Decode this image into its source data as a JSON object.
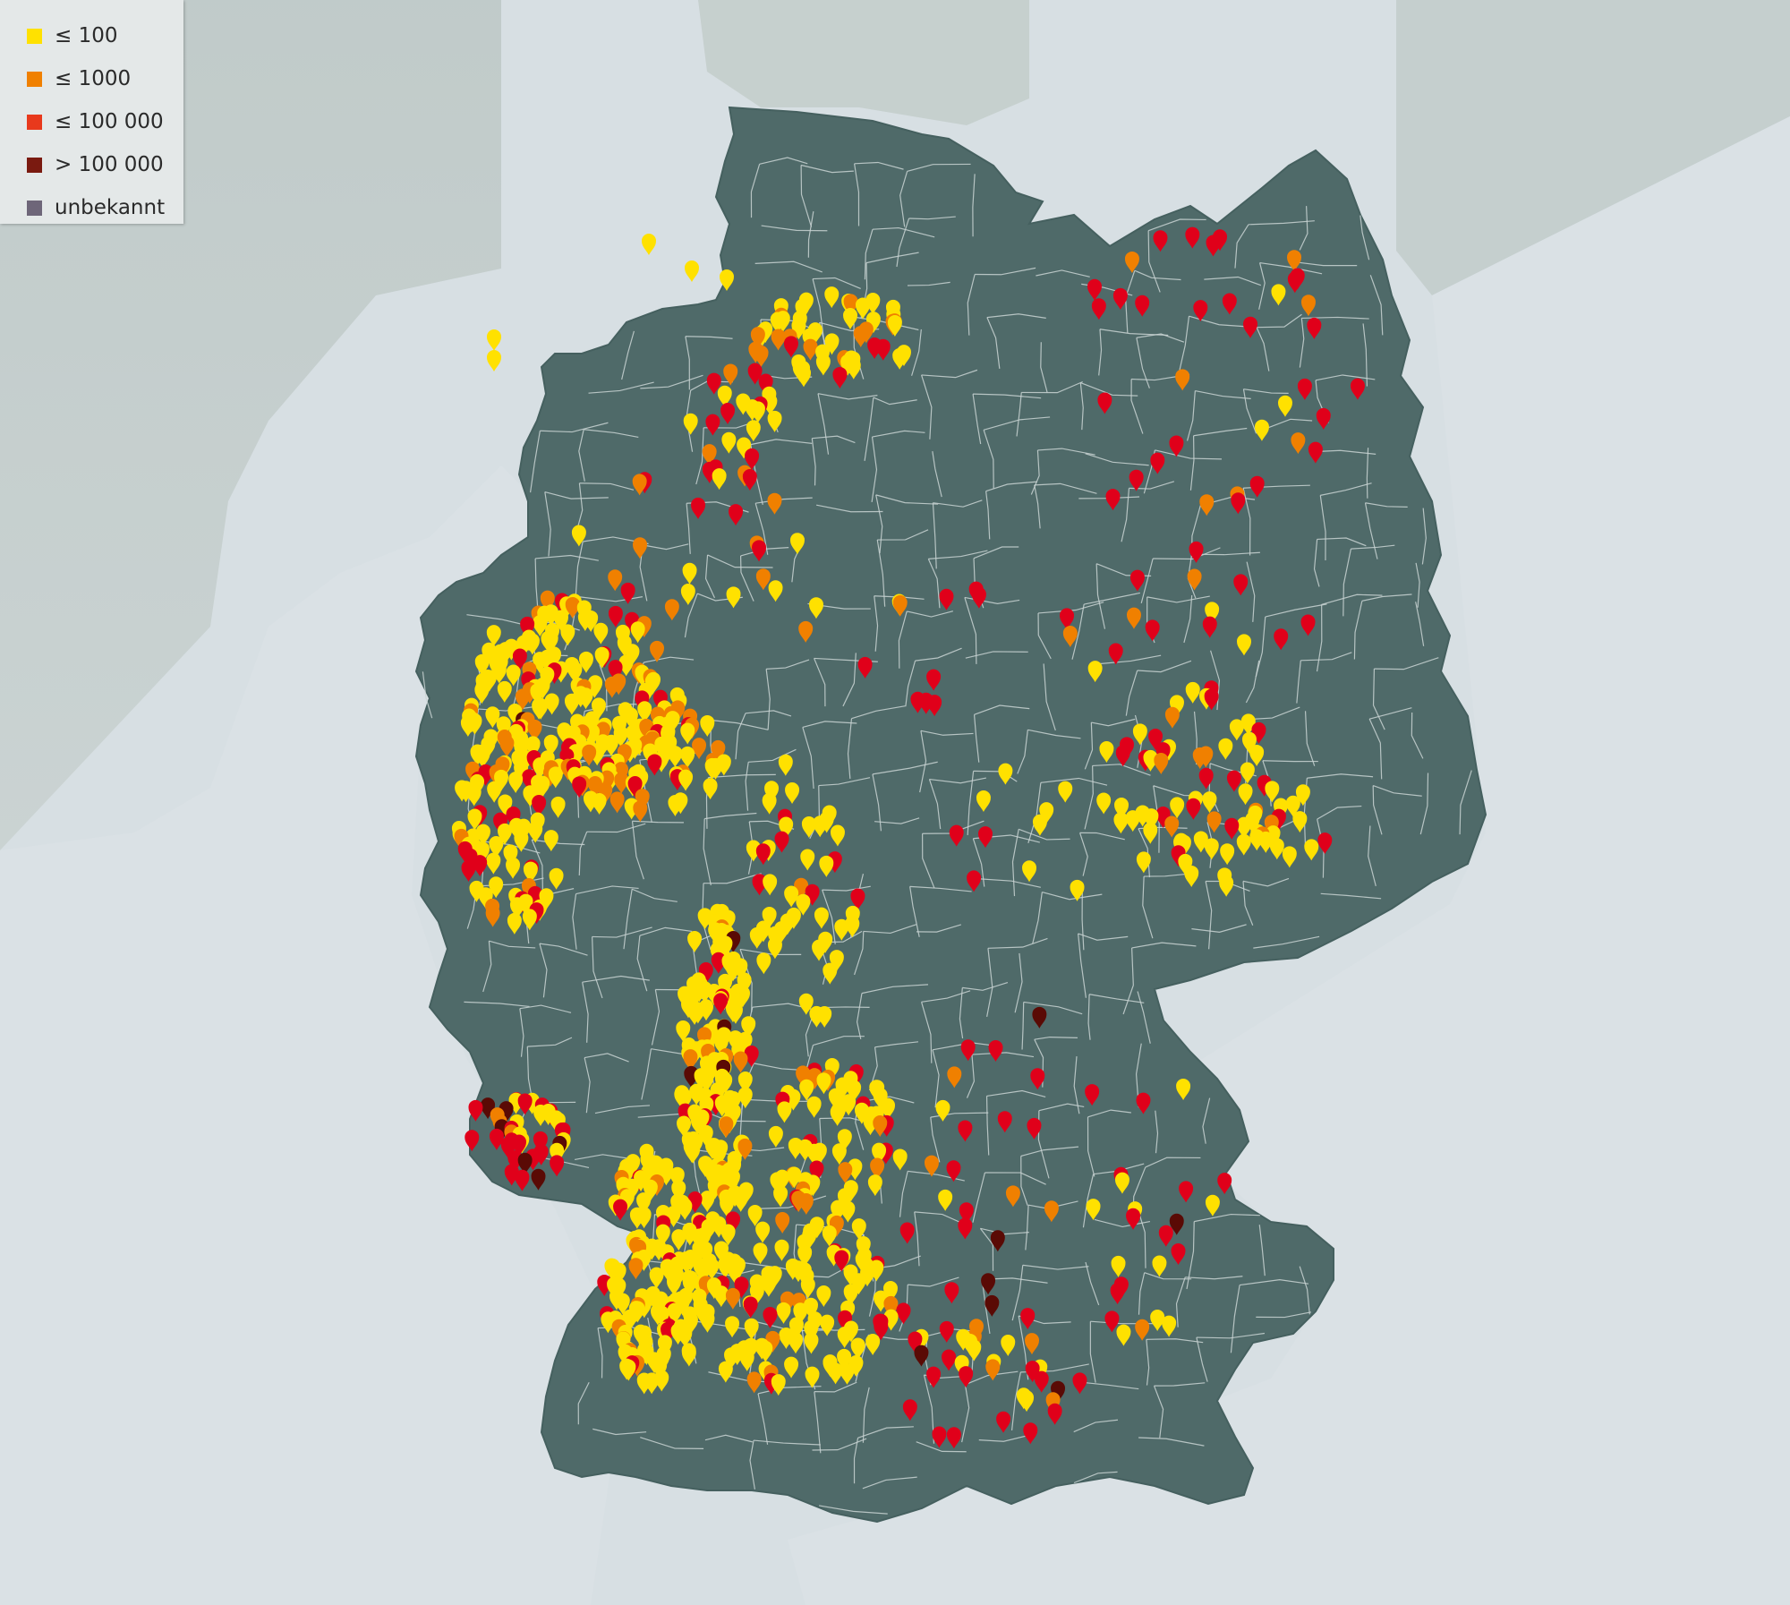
{
  "legend": {
    "items": [
      {
        "label": "≤ 100",
        "color": "#ffe100"
      },
      {
        "label": "≤ 1000",
        "color": "#f08000"
      },
      {
        "label": "≤ 100 000",
        "color": "#e8391c"
      },
      {
        "label": "> 100 000",
        "color": "#7a1a10"
      },
      {
        "label": "unbekannt",
        "color": "#6e6679"
      }
    ]
  },
  "colors": {
    "sea": "#d9e0e4",
    "neighbor_land": "#dde3e7",
    "coast_shade": "#b7c2c0",
    "country_fill": "#4e6a69",
    "district_border": "#c9d3d4",
    "pin_le_100": "#ffe100",
    "pin_le_1000": "#f08000",
    "pin_le_100000": "#e0001a",
    "pin_gt_100000": "#5a0a05",
    "pin_unknown": "#6e6679"
  }
}
